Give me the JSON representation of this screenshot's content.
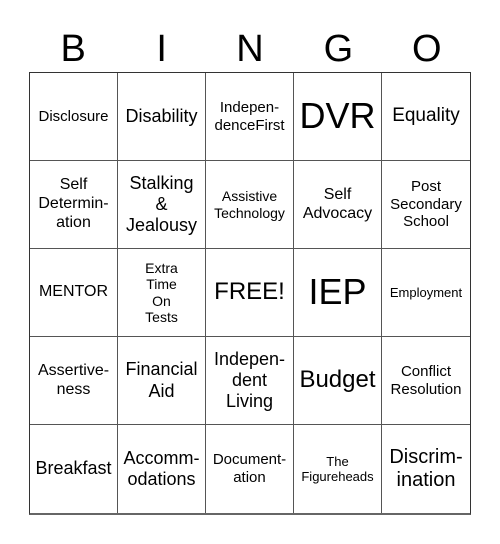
{
  "header": {
    "letters": [
      "B",
      "I",
      "N",
      "G",
      "O"
    ]
  },
  "board": {
    "rows": [
      [
        "Disclosure",
        "Disability",
        "Indepen-\ndenceFirst",
        "DVR",
        "Equality"
      ],
      [
        "Self\nDetermin-\nation",
        "Stalking\n&\nJealousy",
        "Assistive\nTechnology",
        "Self\nAdvocacy",
        "Post\nSecondary\nSchool"
      ],
      [
        "MENTOR",
        "Extra\nTime\nOn\nTests",
        "FREE!",
        "IEP",
        "Employment"
      ],
      [
        "Assertive-\nness",
        "Financial\nAid",
        "Indepen-\ndent\nLiving",
        "Budget",
        "Conflict\nResolution"
      ],
      [
        "Breakfast",
        "Accomm-\nodations",
        "Document-\nation",
        "The\nFigureheads",
        "Discrim-\nination"
      ]
    ],
    "free_space": "FREE!"
  }
}
